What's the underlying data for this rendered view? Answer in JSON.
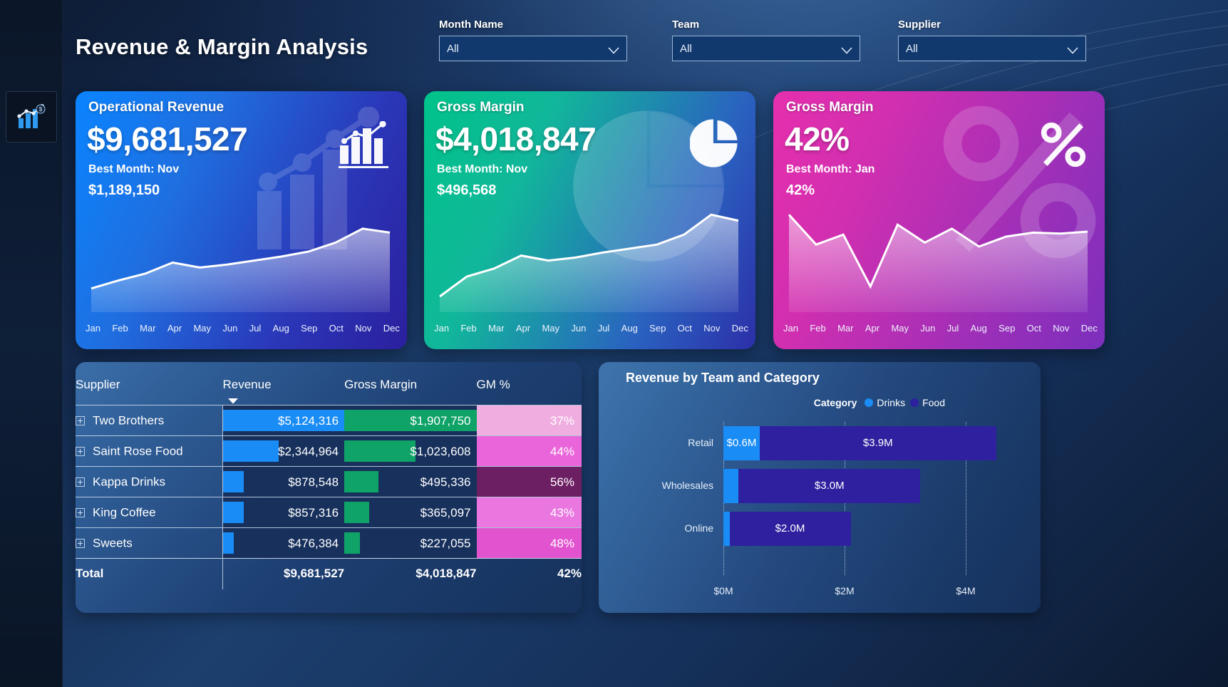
{
  "app": {
    "title": "Revenue & Margin Analysis",
    "rail_icon": "report-chart-icon"
  },
  "slicers": [
    {
      "label": "Month Name",
      "value": "All",
      "icon": "chevron-down-icon"
    },
    {
      "label": "Team",
      "value": "All",
      "icon": "chevron-down-icon"
    },
    {
      "label": "Supplier",
      "value": "All",
      "icon": "chevron-down-icon"
    }
  ],
  "kpis": [
    {
      "title": "Operational Revenue",
      "value": "$9,681,527",
      "best_label": "Best Month: Nov",
      "best_value": "$1,189,150",
      "icon": "bar-chart-trend-icon",
      "months": [
        "Jan",
        "Feb",
        "Mar",
        "Apr",
        "May",
        "Jun",
        "Jul",
        "Aug",
        "Sep",
        "Oct",
        "Nov",
        "Dec"
      ],
      "spark": [
        0.18,
        0.26,
        0.33,
        0.44,
        0.39,
        0.42,
        0.46,
        0.5,
        0.55,
        0.64,
        0.78,
        0.74
      ]
    },
    {
      "title": "Gross Margin",
      "value": "$4,018,847",
      "best_label": "Best Month: Nov",
      "best_value": "$496,568",
      "icon": "pie-chart-icon",
      "months": [
        "Jan",
        "Feb",
        "Mar",
        "Apr",
        "May",
        "Jun",
        "Jul",
        "Aug",
        "Sep",
        "Oct",
        "Nov",
        "Dec"
      ],
      "spark": [
        0.1,
        0.3,
        0.38,
        0.51,
        0.46,
        0.49,
        0.54,
        0.58,
        0.62,
        0.72,
        0.92,
        0.86
      ]
    },
    {
      "title": "Gross Margin",
      "value": "42%",
      "best_label": "Best Month: Jan",
      "best_value": "42%",
      "icon": "percent-icon",
      "months": [
        "Jan",
        "Feb",
        "Mar",
        "Apr",
        "May",
        "Jun",
        "Jul",
        "Aug",
        "Sep",
        "Oct",
        "Nov",
        "Dec"
      ],
      "spark": [
        0.92,
        0.62,
        0.72,
        0.2,
        0.82,
        0.64,
        0.78,
        0.6,
        0.7,
        0.74,
        0.73,
        0.75
      ]
    }
  ],
  "matrix": {
    "columns": [
      "Supplier",
      "Revenue",
      "Gross Margin",
      "GM %"
    ],
    "sorted_by": "Revenue",
    "sort_icon": "sort-descending-icon",
    "expand_icon": "expand-plus-icon",
    "rows": [
      {
        "supplier": "Two Brothers",
        "revenue": "$5,124,316",
        "revenue_pct": 100,
        "gross_margin": "$1,907,750",
        "gm_pct_bar": 100,
        "gm_percent": "37%",
        "gm_percent_value": 37,
        "gm_cell_color": "#f0aee0",
        "gm_text_color": "#ffffff"
      },
      {
        "supplier": "Saint Rose Food",
        "revenue": "$2,344,964",
        "revenue_pct": 46,
        "gross_margin": "$1,023,608",
        "gm_pct_bar": 54,
        "gm_percent": "44%",
        "gm_percent_value": 44,
        "gm_cell_color": "#e965d9",
        "gm_text_color": "#ffffff"
      },
      {
        "supplier": "Kappa Drinks",
        "revenue": "$878,548",
        "revenue_pct": 17,
        "gross_margin": "$495,336",
        "gm_pct_bar": 26,
        "gm_percent": "56%",
        "gm_percent_value": 56,
        "gm_cell_color": "#6d1f63",
        "gm_text_color": "#ffffff"
      },
      {
        "supplier": "King Coffee",
        "revenue": "$857,316",
        "revenue_pct": 17,
        "gross_margin": "$365,097",
        "gm_pct_bar": 19,
        "gm_percent": "43%",
        "gm_percent_value": 43,
        "gm_cell_color": "#ea76e0",
        "gm_text_color": "#ffffff"
      },
      {
        "supplier": "Sweets",
        "revenue": "$476,384",
        "revenue_pct": 9,
        "gross_margin": "$227,055",
        "gm_pct_bar": 12,
        "gm_percent": "48%",
        "gm_percent_value": 48,
        "gm_cell_color": "#e254cf",
        "gm_text_color": "#ffffff"
      }
    ],
    "total": {
      "label": "Total",
      "revenue": "$9,681,527",
      "gross_margin": "$4,018,847",
      "gm_percent": "42%"
    }
  },
  "chart_data": {
    "type": "bar",
    "orientation": "horizontal",
    "stacked": true,
    "title": "Revenue by Team and Category",
    "legend_title": "Category",
    "legend_position": "top-right",
    "categories": [
      "Retail",
      "Wholesales",
      "Online"
    ],
    "series": [
      {
        "name": "Drinks",
        "color": "#1a8cf5",
        "values": [
          0.6,
          0.25,
          0.1
        ],
        "labels": [
          "$0.6M",
          "",
          ""
        ]
      },
      {
        "name": "Food",
        "color": "#2e209e",
        "values": [
          3.9,
          3.0,
          2.0
        ],
        "labels": [
          "$3.9M",
          "$3.0M",
          "$2.0M"
        ]
      }
    ],
    "xlabel": "",
    "ylabel": "",
    "xlim": [
      0,
      5
    ],
    "xticks": [
      0,
      2,
      4
    ],
    "xtick_labels": [
      "$0M",
      "$2M",
      "$4M"
    ],
    "grid": true
  }
}
